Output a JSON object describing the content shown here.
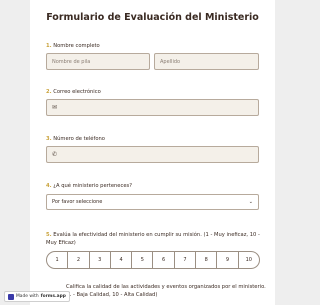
{
  "form": {
    "title": "Formulario de Evaluación del Ministerio",
    "q1": {
      "num": "1.",
      "label": "Nombre completo",
      "first_placeholder": "Nombre de pila",
      "last_placeholder": "Apellido"
    },
    "q2": {
      "num": "2.",
      "label": "Correo electrónico",
      "icon": "envelope-icon"
    },
    "q3": {
      "num": "3.",
      "label": "Número de teléfono",
      "icon": "phone-icon"
    },
    "q4": {
      "num": "4.",
      "label": "¿A qué ministerio perteneces?",
      "selected": "Por favor seleccione"
    },
    "q5": {
      "num": "5.",
      "label": "Evalúa la efectividad del ministerio en cumplir su misión. (1 - Muy ineficaz, 10 - Muy Eficaz)",
      "scale": [
        "1",
        "2",
        "3",
        "4",
        "5",
        "6",
        "7",
        "8",
        "9",
        "10"
      ]
    },
    "q6": {
      "label": "Califica la calidad de las actividades y eventos organizados por el ministerio. (1 - Baja Calidad, 10 - Alta Calidad)"
    }
  },
  "badge": {
    "prefix": "Made with",
    "brand": "forms.app"
  }
}
